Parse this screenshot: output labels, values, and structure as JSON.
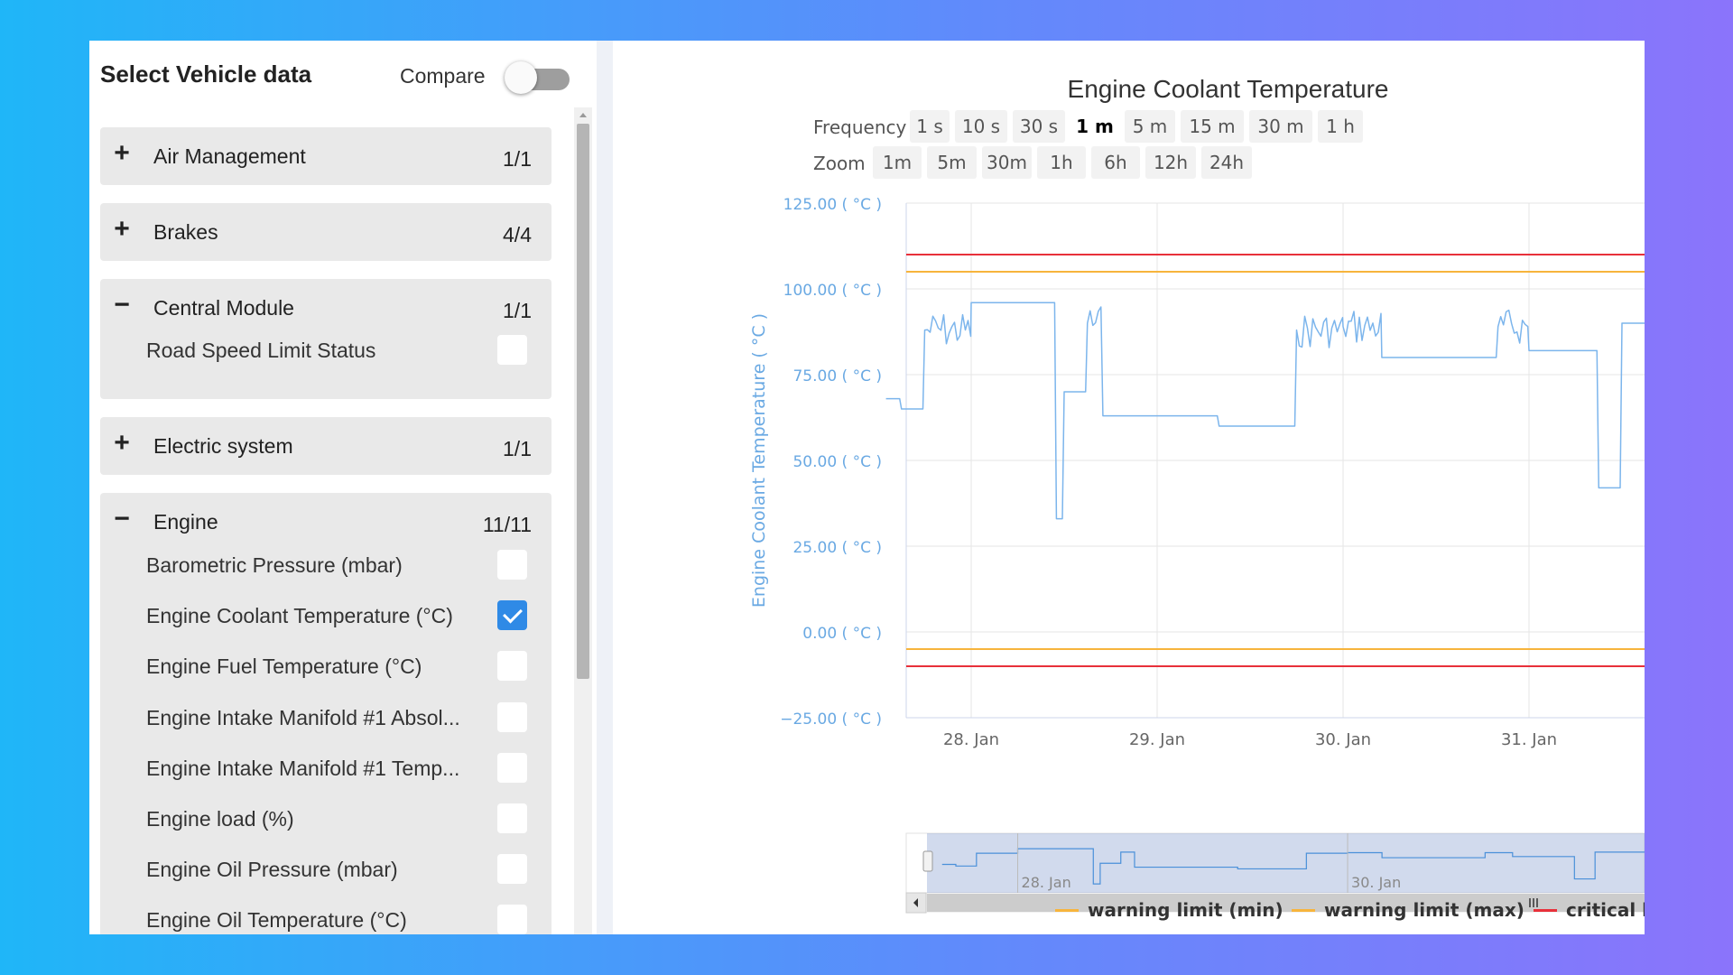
{
  "left_panel": {
    "title": "Select Vehicle data",
    "compare_label": "Compare",
    "compare_on": false,
    "groups": [
      {
        "name": "Air Management",
        "count": "1/1",
        "expanded": false,
        "items": []
      },
      {
        "name": "Brakes",
        "count": "4/4",
        "expanded": false,
        "items": []
      },
      {
        "name": "Central Module",
        "count": "1/1",
        "expanded": true,
        "items": [
          {
            "label": "Road Speed Limit Status",
            "checked": false
          }
        ]
      },
      {
        "name": "Electric system",
        "count": "1/1",
        "expanded": false,
        "items": []
      },
      {
        "name": "Engine",
        "count": "11/11",
        "expanded": true,
        "items": [
          {
            "label": "Barometric Pressure (mbar)",
            "checked": false
          },
          {
            "label": "Engine Coolant Temperature (°C)",
            "checked": true
          },
          {
            "label": "Engine Fuel Temperature (°C)",
            "checked": false
          },
          {
            "label": "Engine Intake Manifold #1 Absol...",
            "checked": false
          },
          {
            "label": "Engine Intake Manifold #1 Temp...",
            "checked": false
          },
          {
            "label": "Engine load (%)",
            "checked": false
          },
          {
            "label": "Engine Oil Pressure (mbar)",
            "checked": false
          },
          {
            "label": "Engine Oil Temperature (°C)",
            "checked": false
          }
        ]
      }
    ]
  },
  "chart": {
    "title": "Engine Coolant Temperature",
    "frequency_label": "Frequency",
    "frequency_options": [
      "1 s",
      "10 s",
      "30 s",
      "1 m",
      "5 m",
      "15 m",
      "30 m",
      "1 h"
    ],
    "frequency_selected": "1 m",
    "zoom_label": "Zoom",
    "zoom_options": [
      "1m",
      "5m",
      "30m",
      "1h",
      "6h",
      "12h",
      "24h"
    ],
    "legend": [
      {
        "label": "warning limit (min)",
        "color": "#f7b43c"
      },
      {
        "label": "warning limit (max)",
        "color": "#f7b43c"
      },
      {
        "label": "critical limit (min)",
        "color": "#e8303a"
      }
    ],
    "navigator_labels": [
      "28. Jan",
      "30. Jan"
    ]
  },
  "chart_data": {
    "type": "line",
    "title": "Engine Coolant Temperature",
    "ylabel": "Engine Coolant Temperature ( °C )",
    "y_ticks": [
      "125.00 ( °C )",
      "100.00 ( °C )",
      "75.00 ( °C )",
      "50.00 ( °C )",
      "25.00 ( °C )",
      "0.00 ( °C )",
      "−25.00 ( °C )"
    ],
    "ylim": [
      -25,
      125
    ],
    "x_ticks": [
      "28. Jan",
      "29. Jan",
      "30. Jan",
      "31. Jan"
    ],
    "x": [
      "27. Jan 13:00",
      "27. Jan 15:00",
      "27. Jan 18:00",
      "28. Jan 00:00",
      "28. Jan 10:00",
      "28. Jan 11:00",
      "28. Jan 12:00",
      "28. Jan 15:00",
      "28. Jan 17:00",
      "29. Jan 08:00",
      "29. Jan 12:00",
      "29. Jan 18:00",
      "30. Jan 00:00",
      "30. Jan 05:00",
      "30. Jan 12:00",
      "30. Jan 20:00",
      "31. Jan 00:00",
      "31. Jan 06:00",
      "31. Jan 09:00",
      "31. Jan 12:00"
    ],
    "series": [
      {
        "values": [
          68,
          65,
          88,
          96,
          96,
          33,
          70,
          90,
          63,
          60,
          60,
          88,
          89,
          80,
          80,
          89,
          82,
          82,
          42,
          90
        ]
      }
    ],
    "limits": [
      {
        "name": "critical limit (max)",
        "value": 110,
        "color": "#e8303a"
      },
      {
        "name": "warning limit (max)",
        "value": 105,
        "color": "#f7b43c"
      },
      {
        "name": "warning limit (min)",
        "value": -5,
        "color": "#f7b43c"
      },
      {
        "name": "critical limit (min)",
        "value": -10,
        "color": "#e8303a"
      }
    ],
    "grid": true
  }
}
